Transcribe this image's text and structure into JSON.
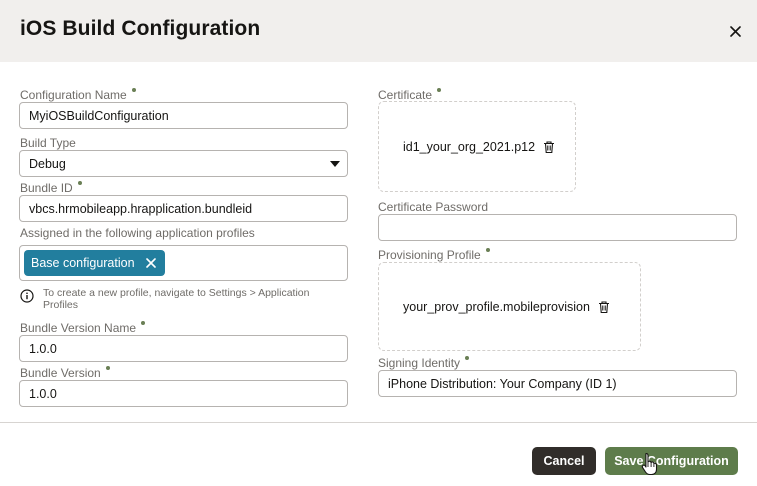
{
  "dialog": {
    "title": "iOS Build Configuration"
  },
  "form": {
    "configuration_name": {
      "label": "Configuration Name",
      "value": "MyiOSBuildConfiguration"
    },
    "build_type": {
      "label": "Build Type",
      "value": "Debug"
    },
    "bundle_id": {
      "label": "Bundle ID",
      "value": "vbcs.hrmobileapp.hrapplication.bundleid"
    },
    "profiles": {
      "label": "Assigned in the following application profiles",
      "chip": "Base configuration",
      "hint": "To create a new profile, navigate to Settings > Application Profiles"
    },
    "bundle_version_name": {
      "label": "Bundle Version Name",
      "value": "1.0.0"
    },
    "bundle_version": {
      "label": "Bundle Version",
      "value": "1.0.0"
    },
    "certificate": {
      "label": "Certificate",
      "file": "id1_your_org_2021.p12"
    },
    "certificate_password": {
      "label": "Certificate Password",
      "value": ""
    },
    "provisioning_profile": {
      "label": "Provisioning Profile",
      "file": "your_prov_profile.mobileprovision"
    },
    "signing_identity": {
      "label": "Signing Identity",
      "value": "iPhone Distribution: Your Company (ID 1)"
    }
  },
  "footer": {
    "cancel_label": "Cancel",
    "save_label": "Save Configuration"
  },
  "colors": {
    "header_bg": "#f1efed",
    "chip_bg": "#227e9e",
    "save_bg": "#5e7c4b",
    "cancel_bg": "#312d2a",
    "required_dot": "#6a7f55"
  },
  "icons": [
    "close-icon",
    "chip-remove-icon",
    "info-icon",
    "trash-icon",
    "chevron-down-icon",
    "pointer-cursor-icon"
  ]
}
